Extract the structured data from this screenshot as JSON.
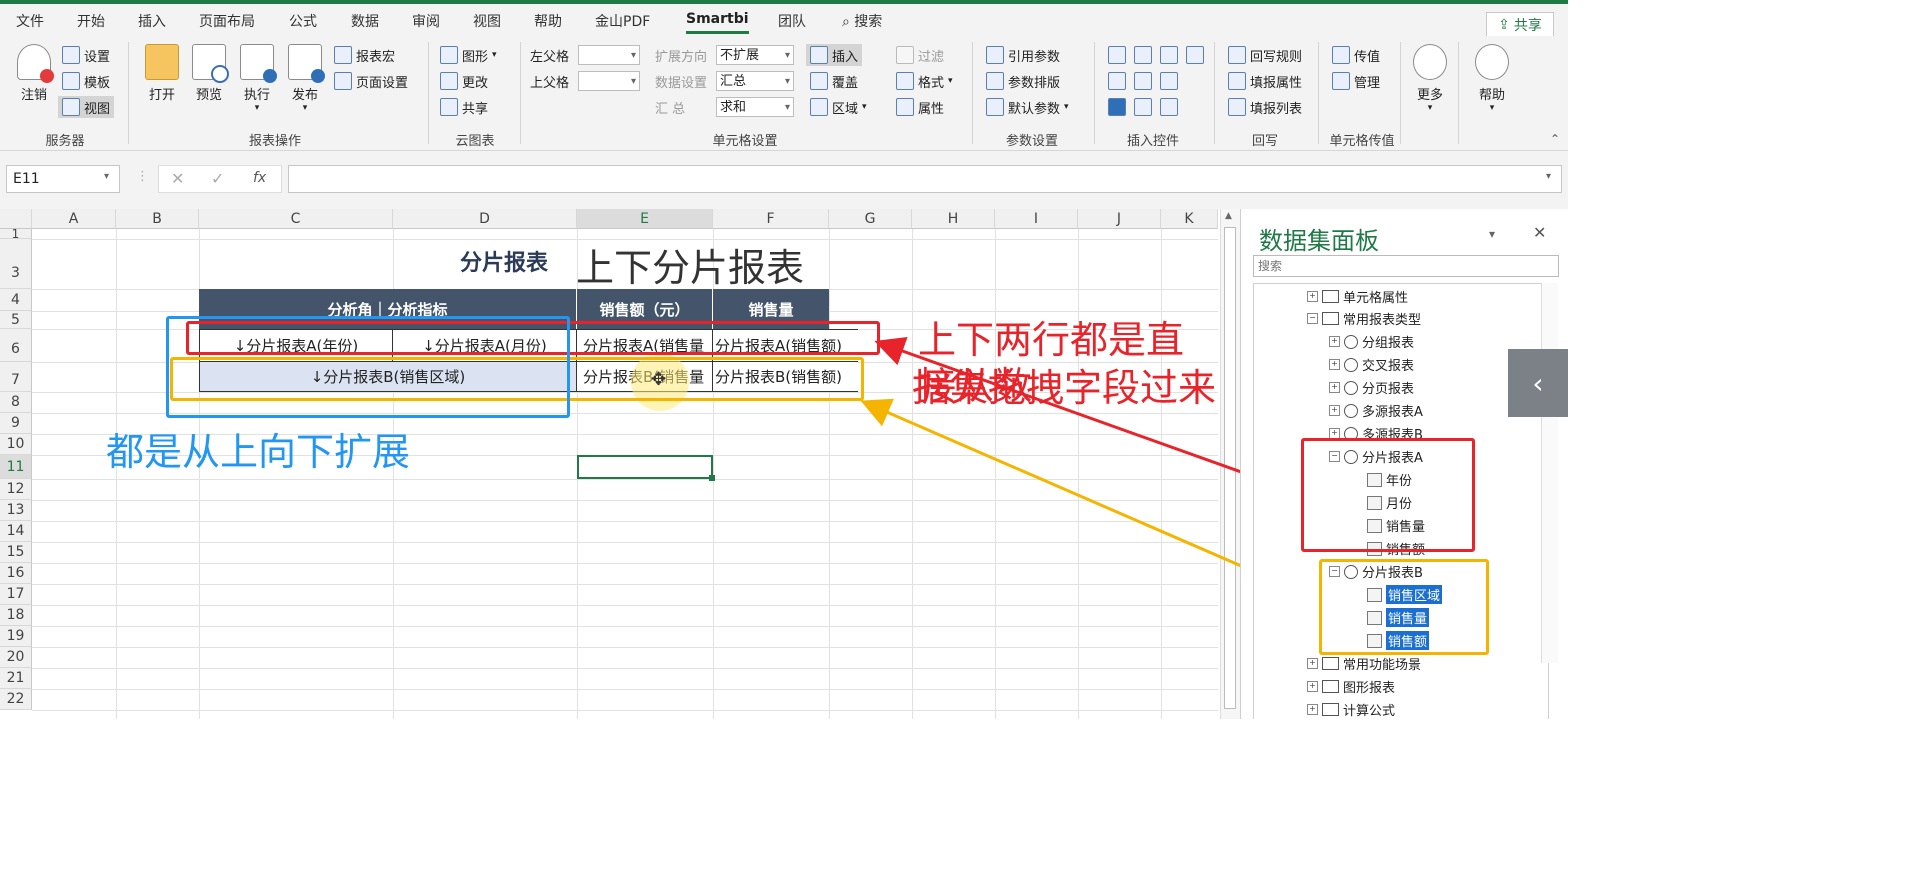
{
  "ribbon_tabs": [
    "文件",
    "开始",
    "插入",
    "页面布局",
    "公式",
    "数据",
    "审阅",
    "视图",
    "帮助",
    "金山PDF",
    "Smartbi",
    "团队",
    "搜索"
  ],
  "active_tab": "Smartbi",
  "share_label": "共享",
  "groups": {
    "server": {
      "label": "服务器",
      "logout": "注销",
      "settings": "设置",
      "template": "模板",
      "view": "视图"
    },
    "report_ops": {
      "label": "报表操作",
      "open": "打开",
      "preview": "预览",
      "execute": "执行",
      "publish": "发布",
      "macro": "报表宏",
      "page_setup": "页面设置"
    },
    "cloud_chart": {
      "label": "云图表",
      "chart": "图形",
      "edit": "更改",
      "share": "共享"
    },
    "cell_settings": {
      "label": "单元格设置",
      "left_parent": "左父格",
      "top_parent": "上父格",
      "expand_dir": "扩展方向",
      "data_settings": "数据设置",
      "summary": "汇 总",
      "expand_value": "不扩展",
      "summary_value": "汇总",
      "agg_value": "求和",
      "insert": "插入",
      "cover": "覆盖",
      "area": "区域",
      "filter": "过滤",
      "format": "格式",
      "props": "属性"
    },
    "param_settings": {
      "label": "参数设置",
      "ref_params": "引用参数",
      "param_layout": "参数排版",
      "default_params": "默认参数"
    },
    "insert_controls": {
      "label": "插入控件"
    },
    "writeback": {
      "label": "回写",
      "rules": "回写规则",
      "fill_props": "填报属性",
      "fill_list": "填报列表"
    },
    "cell_transfer": {
      "label": "单元格传值",
      "transfer": "传值",
      "manage": "管理"
    },
    "more": "更多",
    "help": "帮助"
  },
  "formula_bar": {
    "name_box": "E11",
    "fx": "fx",
    "value": ""
  },
  "columns": [
    "A",
    "B",
    "C",
    "D",
    "E",
    "F",
    "G",
    "H",
    "I",
    "J",
    "K"
  ],
  "rows": [
    "1",
    "3",
    "4",
    "5",
    "6",
    "7",
    "8",
    "9",
    "10",
    "11",
    "12",
    "13",
    "14",
    "15",
    "16",
    "17",
    "18",
    "19",
    "20",
    "21",
    "22"
  ],
  "report": {
    "title_bold": "分片报表",
    "title_large": "上下分片报表",
    "header_dim": "分析角｜分析指标",
    "header_sales_amount": "销售额（元）",
    "header_sales_qty": "销售量",
    "row6_c": "↓分片报表A(年份)",
    "row6_d": "↓分片报表A(月份)",
    "row6_e": "分片报表A(销售量",
    "row6_f": "分片报表A(销售额)",
    "row7_cd": "↓分片报表B(销售区域)",
    "row7_e": "分片报表B(销售量",
    "row7_f": "分片报表B(销售额)"
  },
  "annotations": {
    "red_note_line1": "上下两行都是直接从数",
    "red_note_line2": "据集拖拽字段过来",
    "blue_note": "都是从上向下扩展"
  },
  "panel": {
    "title": "数据集面板",
    "search_placeholder": "搜索",
    "items": {
      "cell_props": "单元格属性",
      "common_types": "常用报表类型",
      "group_report": "分组报表",
      "cross_report": "交叉报表",
      "page_report": "分页报表",
      "multi_a": "多源报表A",
      "multi_b": "多源报表B",
      "slice_a": "分片报表A",
      "year": "年份",
      "month": "月份",
      "qty_a": "销售量",
      "amount_a": "销售额",
      "slice_b": "分片报表B",
      "region_b": "销售区域",
      "qty_b": "销售量",
      "amount_b": "销售额",
      "func_scenes": "常用功能场景",
      "chart_reports": "图形报表",
      "calc_formula": "计算公式"
    }
  },
  "colors": {
    "green": "#1f7a45",
    "header_navy": "#44546a",
    "red": "#e8232a",
    "blue": "#2196f3",
    "amber": "#f5b400",
    "select_blue": "#1a6fd0"
  }
}
